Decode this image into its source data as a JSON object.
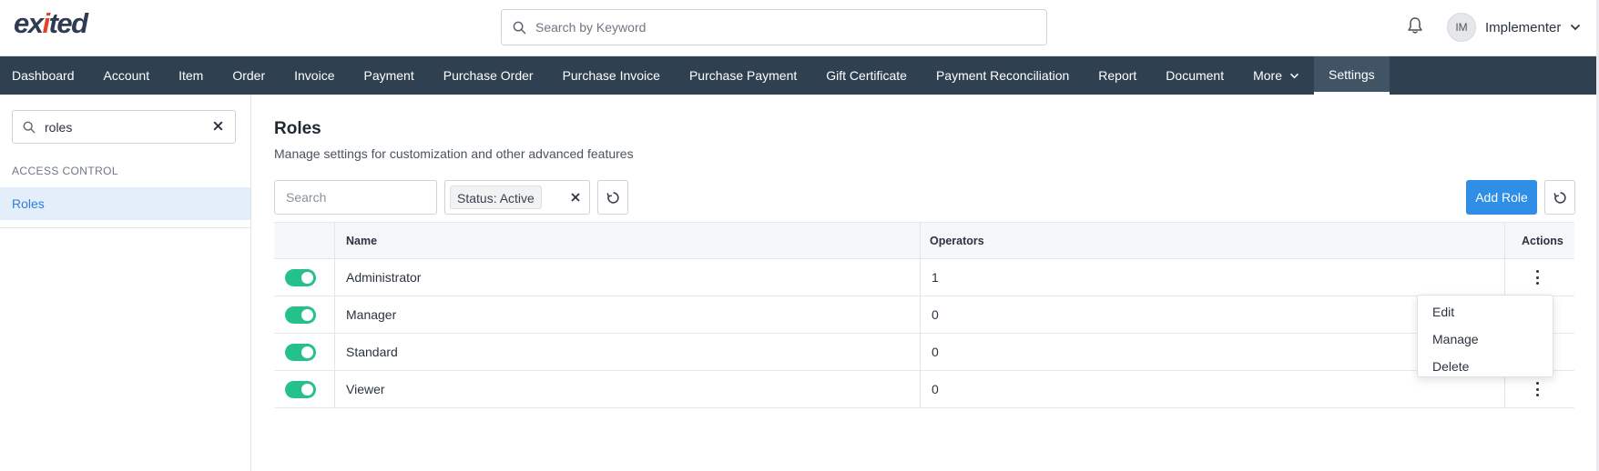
{
  "header": {
    "logo_text_a": "ex",
    "logo_text_b": "i",
    "logo_text_c": "ted",
    "search_placeholder": "Search by Keyword",
    "user_initials": "IM",
    "user_name": "Implementer",
    "icons": {
      "search": "search-icon",
      "bell": "bell-icon",
      "chevron": "chevron-down-icon"
    }
  },
  "nav": {
    "items": [
      "Dashboard",
      "Account",
      "Item",
      "Order",
      "Invoice",
      "Payment",
      "Purchase Order",
      "Purchase Invoice",
      "Purchase Payment",
      "Gift Certificate",
      "Payment Reconciliation",
      "Report",
      "Document",
      "More",
      "Settings"
    ],
    "active": "Settings"
  },
  "sidebar": {
    "search_value": "roles",
    "section_label": "ACCESS CONTROL",
    "active_item": "Roles"
  },
  "main": {
    "title": "Roles",
    "subtitle": "Manage settings for customization and other advanced features",
    "search_placeholder": "Search",
    "status_chip": "Status: Active",
    "add_button": "Add Role"
  },
  "table": {
    "headers": {
      "name": "Name",
      "operators": "Operators",
      "actions": "Actions"
    },
    "rows": [
      {
        "active": true,
        "name": "Administrator",
        "operators": "1"
      },
      {
        "active": true,
        "name": "Manager",
        "operators": "0"
      },
      {
        "active": true,
        "name": "Standard",
        "operators": "0"
      },
      {
        "active": true,
        "name": "Viewer",
        "operators": "0"
      }
    ]
  },
  "menu": {
    "items": [
      "Edit",
      "Manage",
      "Delete"
    ]
  },
  "colors": {
    "nav_bg": "#2f4050",
    "accent_blue": "#2f8ee6",
    "toggle_green": "#24c18a",
    "logo_dark": "#2e3b52",
    "logo_red": "#e0432c"
  }
}
